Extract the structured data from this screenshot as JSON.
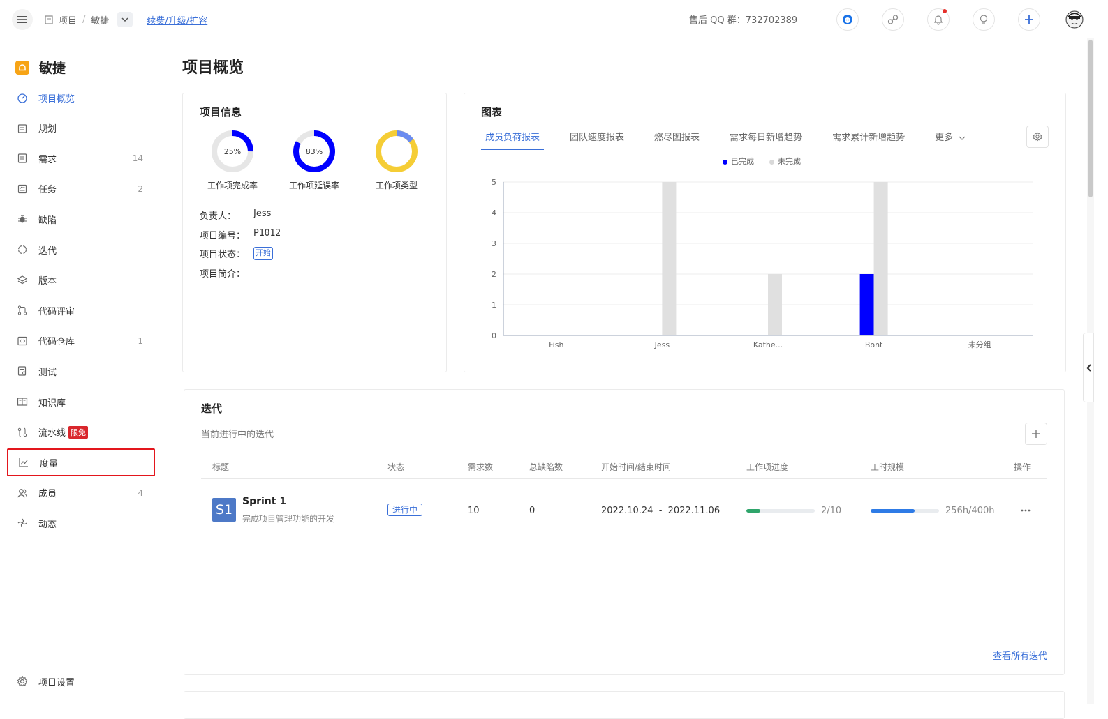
{
  "topbar": {
    "breadcrumb_project": "项目",
    "breadcrumb_current": "敏捷",
    "renew_link": "续费/升级/扩容",
    "qq_group": "售后 QQ 群：732702389"
  },
  "sidebar": {
    "brand": "敏捷",
    "items": [
      {
        "label": "项目概览",
        "count": "",
        "icon": "dashboard-icon"
      },
      {
        "label": "规划",
        "count": "",
        "icon": "calendar-icon"
      },
      {
        "label": "需求",
        "count": "14",
        "icon": "document-icon"
      },
      {
        "label": "任务",
        "count": "2",
        "icon": "checklist-icon"
      },
      {
        "label": "缺陷",
        "count": "",
        "icon": "bug-icon"
      },
      {
        "label": "迭代",
        "count": "",
        "icon": "cycle-icon"
      },
      {
        "label": "版本",
        "count": "",
        "icon": "layers-icon"
      },
      {
        "label": "代码评审",
        "count": "",
        "icon": "merge-icon"
      },
      {
        "label": "代码仓库",
        "count": "1",
        "icon": "code-icon"
      },
      {
        "label": "测试",
        "count": "",
        "icon": "test-icon"
      },
      {
        "label": "知识库",
        "count": "",
        "icon": "book-icon"
      },
      {
        "label": "流水线",
        "count": "",
        "icon": "pipeline-icon",
        "badge": "限免"
      },
      {
        "label": "度量",
        "count": "",
        "icon": "chart-icon"
      },
      {
        "label": "成员",
        "count": "4",
        "icon": "users-icon"
      },
      {
        "label": "动态",
        "count": "",
        "icon": "activity-icon"
      }
    ],
    "settings_label": "项目设置"
  },
  "main": {
    "title": "项目概览",
    "project_info": {
      "title": "项目信息",
      "donuts": [
        {
          "label": "工作项完成率",
          "value": "25%",
          "percent": 25,
          "color": "#0000ff"
        },
        {
          "label": "工作项延误率",
          "value": "83%",
          "percent": 83,
          "color": "#0000ff"
        },
        {
          "label": "工作项类型",
          "value": "",
          "percent": 15,
          "color": "#f5cd35",
          "accent": "#6b8cf0"
        }
      ],
      "owner_key": "负责人：",
      "owner_value": "Jess",
      "code_key": "项目编号：",
      "code_value": "P1012",
      "status_key": "项目状态：",
      "status_value": "开始",
      "desc_key": "项目简介："
    },
    "charts": {
      "title": "图表",
      "tabs": [
        "成员负荷报表",
        "团队速度报表",
        "燃尽图报表",
        "需求每日新增趋势",
        "需求累计新增趋势",
        "更多"
      ],
      "legend": [
        "已完成",
        "未完成"
      ]
    },
    "iterations": {
      "title": "迭代",
      "subtitle": "当前进行中的迭代",
      "headers": [
        "标题",
        "状态",
        "需求数",
        "总缺陷数",
        "开始时间/结束时间",
        "工作项进度",
        "工时规模",
        "操作"
      ],
      "row": {
        "badge": "S1",
        "name": "Sprint 1",
        "desc": "完成项目管理功能的开发",
        "status": "进行中",
        "requirements": "10",
        "defects": "0",
        "dates": "2022.10.24  -  2022.11.06",
        "progress_text": "2/10",
        "progress": 0.2,
        "hours_text": "256h/400h",
        "hours": 0.64
      },
      "view_all": "查看所有迭代"
    }
  },
  "chart_data": {
    "type": "bar",
    "categories": [
      "Fish",
      "Jess",
      "Kathe...",
      "Bont",
      "未分组"
    ],
    "series": [
      {
        "name": "已完成",
        "values": [
          0,
          0,
          0,
          2,
          0
        ],
        "color": "#0000ff"
      },
      {
        "name": "未完成",
        "values": [
          0,
          5,
          2,
          5,
          0
        ],
        "color": "#e0e0e0"
      }
    ],
    "ylim": [
      0,
      5
    ],
    "yticks": [
      0,
      1,
      2,
      3,
      4,
      5
    ],
    "legend_position": "top"
  }
}
